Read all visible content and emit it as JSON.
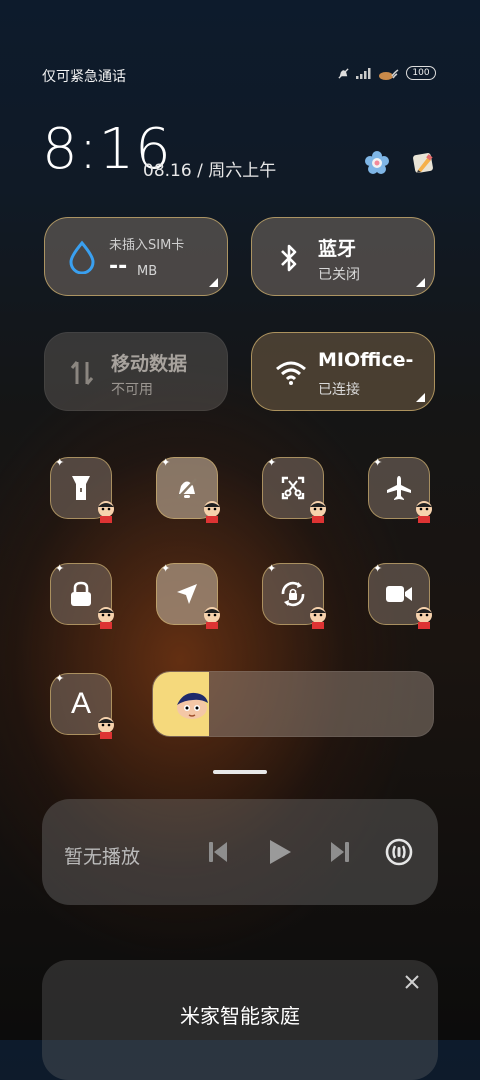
{
  "status_bar": {
    "carrier_text": "仅可紧急通话",
    "battery_level": "100",
    "icons": [
      "silent-bell-icon",
      "signal-icon",
      "wifi-icon",
      "battery-icon"
    ]
  },
  "clock": {
    "time": "8:16",
    "date": "08.16 / 周六上午"
  },
  "header_icons": [
    "flower-settings-icon",
    "edit-pencil-icon"
  ],
  "tiles": {
    "data": {
      "title": "未插入SIM卡",
      "value": "--",
      "unit": "MB"
    },
    "bluetooth": {
      "title": "蓝牙",
      "status": "已关闭"
    },
    "mobile_data": {
      "title": "移动数据",
      "status": "不可用"
    },
    "wlan": {
      "title": "MIOffice-",
      "status": "已连接"
    }
  },
  "toggles": [
    {
      "name": "flashlight-icon",
      "on": false
    },
    {
      "name": "mute-bell-icon",
      "on": true
    },
    {
      "name": "screenshot-icon",
      "on": false
    },
    {
      "name": "airplane-icon",
      "on": false
    },
    {
      "name": "lock-icon",
      "on": false
    },
    {
      "name": "location-icon",
      "on": true
    },
    {
      "name": "rotation-lock-icon",
      "on": false
    },
    {
      "name": "video-icon",
      "on": false
    }
  ],
  "auto_brightness_label": "A",
  "brightness_level": 0.2,
  "media": {
    "label": "暂无播放"
  },
  "smart_home_card": {
    "title": "米家智能家庭"
  },
  "colors": {
    "accent_border": "#cdaf6e",
    "brightness_fill": "#f5d97c"
  }
}
